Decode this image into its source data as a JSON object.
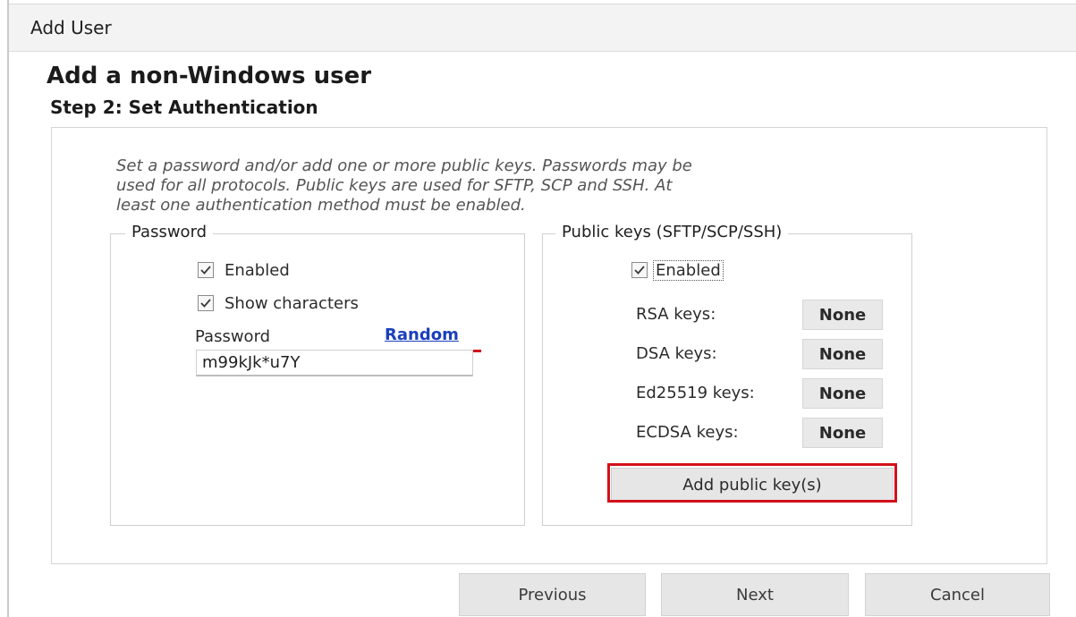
{
  "window": {
    "title": "Add User"
  },
  "heading": "Add a non-Windows user",
  "step": "Step 2: Set Authentication",
  "intro_lines": [
    "Set a password and/or add one or more public keys.  Passwords may be",
    "used for all protocols.  Public keys are used for SFTP, SCP and SSH.  At",
    "least one authentication method must be enabled."
  ],
  "password_group": {
    "legend": "Password",
    "enabled_label": "Enabled",
    "enabled_checked": true,
    "show_characters_label": "Show characters",
    "show_characters_checked": true,
    "password_label": "Password",
    "random_link": "Random",
    "password_value": "m99kJk*u7Y"
  },
  "keys_group": {
    "legend": "Public keys (SFTP/SCP/SSH)",
    "enabled_label": "Enabled",
    "enabled_checked": true,
    "rows": [
      {
        "label": "RSA keys:",
        "value": "None"
      },
      {
        "label": "DSA keys:",
        "value": "None"
      },
      {
        "label": "Ed25519 keys:",
        "value": "None"
      },
      {
        "label": "ECDSA keys:",
        "value": "None"
      }
    ],
    "add_button": "Add public key(s)"
  },
  "footer": {
    "previous": "Previous",
    "next": "Next",
    "cancel": "Cancel"
  },
  "colors": {
    "highlight": "#d3101a",
    "link": "#1a3fbd"
  }
}
